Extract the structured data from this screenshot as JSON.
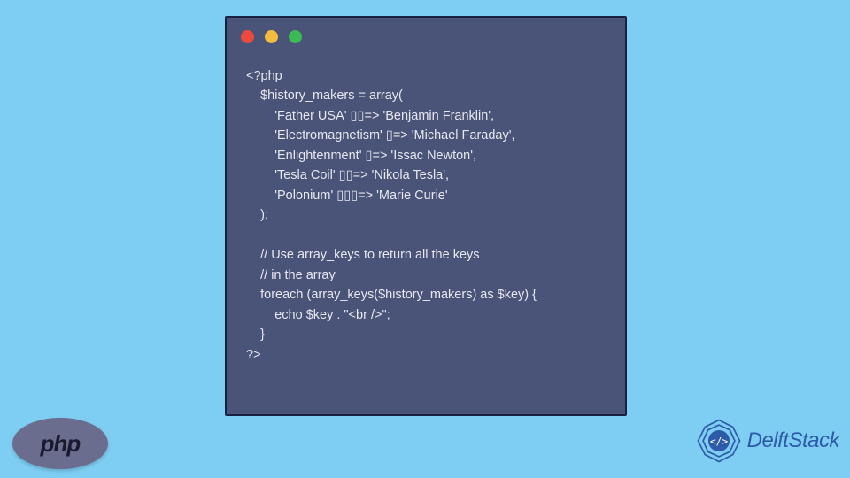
{
  "code": {
    "line1": "<?php",
    "line2": "    $history_makers = array(",
    "line3": "        'Father USA' ▯▯=> 'Benjamin Franklin',",
    "line4": "        'Electromagnetism' ▯=> 'Michael Faraday',",
    "line5": "        'Enlightenment' ▯=> 'Issac Newton',",
    "line6": "        'Tesla Coil' ▯▯=> 'Nikola Tesla',",
    "line7": "        'Polonium' ▯▯▯=> 'Marie Curie'",
    "line8": "    );",
    "line9": "",
    "line10": "    // Use array_keys to return all the keys",
    "line11": "    // in the array",
    "line12": "    foreach (array_keys($history_makers) as $key) {",
    "line13": "        echo $key . \"<br />\";",
    "line14": "    }",
    "line15": "?>"
  },
  "logos": {
    "php": "php",
    "delft": "DelftStack"
  }
}
